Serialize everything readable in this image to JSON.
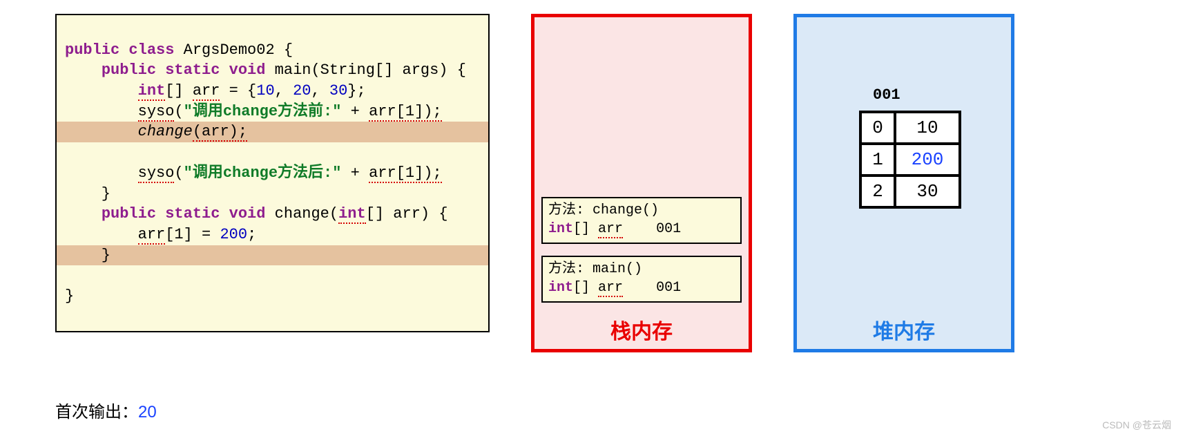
{
  "code": {
    "className": "ArgsDemo02",
    "mainSig": "main(String[] args) {",
    "arrDecl_pre": "[] ",
    "arrName": "arr",
    "arrDecl_post": " = {",
    "vals": [
      "10",
      "20",
      "30"
    ],
    "syso": "syso",
    "str_before": "\"调用change方法前:\"",
    "str_after": "\"调用change方法后:\"",
    "plus": " + ",
    "arrIdx": "arr[1]);",
    "changeCall": "change",
    "changeArg": "(arr);",
    "changeSig": "change(",
    "changeParamType": "int",
    "changeParamRest": "[] arr) {",
    "assignLhs": "arr",
    "assignIdx": "[1] = ",
    "assignVal": "200",
    "semi": ";",
    "kw_public": "public",
    "kw_class": "class",
    "kw_static": "static",
    "kw_void": "void",
    "kw_int": "int"
  },
  "output": {
    "label": "首次输出：",
    "value": "20"
  },
  "stack": {
    "label": "栈内存",
    "frames": [
      {
        "title": "方法: change()",
        "type": "int",
        "rest": "[] ",
        "arr": "arr",
        "addr": "001"
      },
      {
        "title": "方法: main()",
        "type": "int",
        "rest": "[] ",
        "arr": "arr",
        "addr": "001"
      }
    ]
  },
  "heap": {
    "label": "堆内存",
    "addr": "001",
    "rows": [
      {
        "idx": "0",
        "val": "10",
        "hl": false
      },
      {
        "idx": "1",
        "val": "200",
        "hl": true
      },
      {
        "idx": "2",
        "val": "30",
        "hl": false
      }
    ]
  },
  "watermark": "CSDN @苍云烟"
}
